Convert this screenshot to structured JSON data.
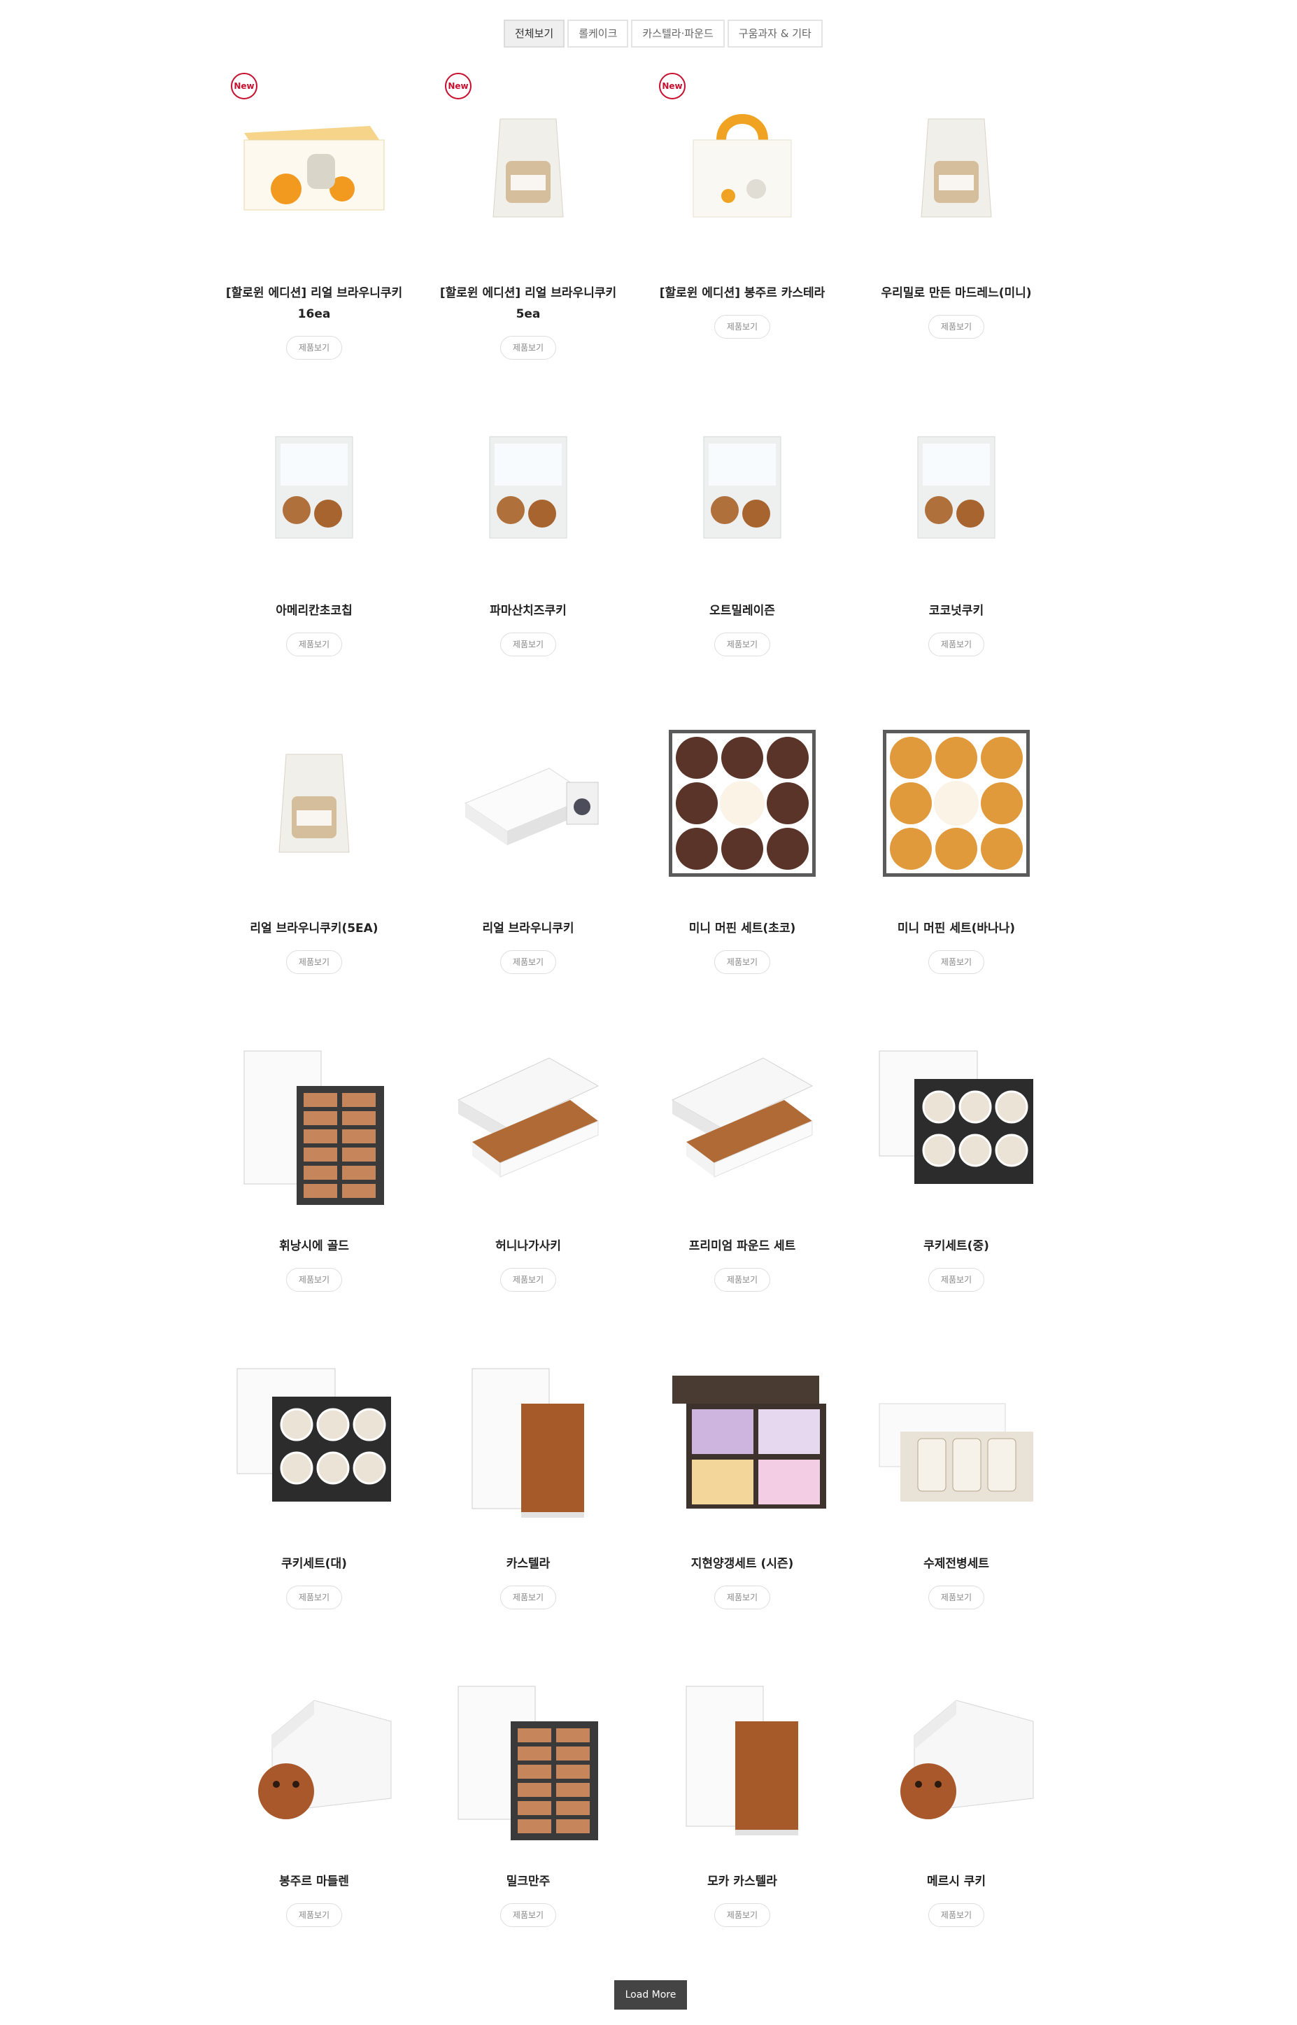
{
  "tabs": [
    "전체보기",
    "롤케이크",
    "카스텔라·파운드",
    "구움과자 & 기타"
  ],
  "active_tab": 0,
  "badge_label": "New",
  "view_button_label": "제품보기",
  "load_more_label": "Load More",
  "products": [
    {
      "name": "[할로윈 에디션] 리얼 브라우니쿠키 16ea",
      "is_new": true,
      "image": "halloween-box"
    },
    {
      "name": "[할로윈 에디션] 리얼 브라우니쿠키 5ea",
      "is_new": true,
      "image": "clear-bag"
    },
    {
      "name": "[할로윈 에디션] 봉주르 카스테라",
      "is_new": true,
      "image": "handle-box"
    },
    {
      "name": "우리밀로 만든 마드레느(미니)",
      "is_new": false,
      "image": "clear-bag"
    },
    {
      "name": "아메리칸초코칩",
      "is_new": false,
      "image": "cookie-bag"
    },
    {
      "name": "파마산치즈쿠키",
      "is_new": false,
      "image": "cookie-bag"
    },
    {
      "name": "오트밀레이즌",
      "is_new": false,
      "image": "cookie-bag"
    },
    {
      "name": "코코넛쿠키",
      "is_new": false,
      "image": "cookie-bag"
    },
    {
      "name": "리얼 브라우니쿠키(5EA)",
      "is_new": false,
      "image": "clear-bag"
    },
    {
      "name": "리얼 브라우니쿠키",
      "is_new": false,
      "image": "white-box"
    },
    {
      "name": "미니 머핀 세트(초코)",
      "is_new": false,
      "image": "muffin-choco"
    },
    {
      "name": "미니 머핀 세트(바나나)",
      "is_new": false,
      "image": "muffin-banana"
    },
    {
      "name": "휘낭시에 골드",
      "is_new": false,
      "image": "gift-set"
    },
    {
      "name": "허니나가사키",
      "is_new": false,
      "image": "pound-box"
    },
    {
      "name": "프리미엄 파운드 세트",
      "is_new": false,
      "image": "pound-box"
    },
    {
      "name": "쿠키세트(중)",
      "is_new": false,
      "image": "cookie-set"
    },
    {
      "name": "쿠키세트(대)",
      "is_new": false,
      "image": "cookie-set"
    },
    {
      "name": "카스텔라",
      "is_new": false,
      "image": "castella"
    },
    {
      "name": "지현양갱세트 (시즌)",
      "is_new": false,
      "image": "yanggaeng"
    },
    {
      "name": "수제전병세트",
      "is_new": false,
      "image": "jar-set"
    },
    {
      "name": "봉주르 마들렌",
      "is_new": false,
      "image": "house-box"
    },
    {
      "name": "밀크만주",
      "is_new": false,
      "image": "gift-set"
    },
    {
      "name": "모카 카스텔라",
      "is_new": false,
      "image": "castella"
    },
    {
      "name": "메르시 쿠키",
      "is_new": false,
      "image": "house-box"
    }
  ]
}
